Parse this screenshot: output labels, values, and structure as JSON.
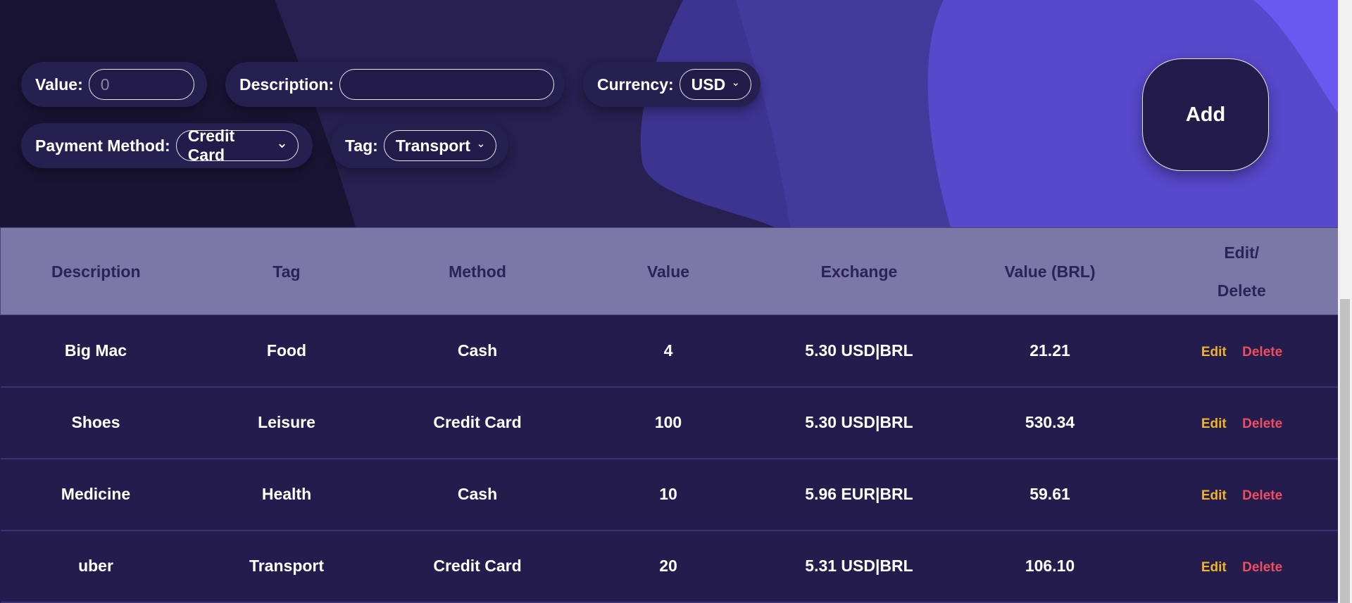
{
  "form": {
    "value_label": "Value:",
    "value_placeholder": "0",
    "description_label": "Description:",
    "description_value": "",
    "currency_label": "Currency:",
    "currency_selected": "USD",
    "payment_label": "Payment Method:",
    "payment_selected": "Credit Card",
    "tag_label": "Tag:",
    "tag_selected": "Transport",
    "add_label": "Add"
  },
  "table": {
    "headers": {
      "description": "Description",
      "tag": "Tag",
      "method": "Method",
      "value": "Value",
      "exchange": "Exchange",
      "value_brl": "Value (BRL)",
      "edit_delete_line1": "Edit/",
      "edit_delete_line2": "Delete"
    },
    "rows": [
      {
        "description": "Big Mac",
        "tag": "Food",
        "method": "Cash",
        "value": "4",
        "exchange": "5.30 USD|BRL",
        "value_brl": "21.21",
        "edit": "Edit",
        "delete": "Delete"
      },
      {
        "description": "Shoes",
        "tag": "Leisure",
        "method": "Credit Card",
        "value": "100",
        "exchange": "5.30 USD|BRL",
        "value_brl": "530.34",
        "edit": "Edit",
        "delete": "Delete"
      },
      {
        "description": "Medicine",
        "tag": "Health",
        "method": "Cash",
        "value": "10",
        "exchange": "5.96 EUR|BRL",
        "value_brl": "59.61",
        "edit": "Edit",
        "delete": "Delete"
      },
      {
        "description": "uber",
        "tag": "Transport",
        "method": "Credit Card",
        "value": "20",
        "exchange": "5.31 USD|BRL",
        "value_brl": "106.10",
        "edit": "Edit",
        "delete": "Delete"
      }
    ]
  },
  "icons": {
    "select_arrow": "chevron-down-icon"
  },
  "colors": {
    "background_dark": "#1c1638",
    "wave_purple": "#4f44c4",
    "wave_bright": "#6a56f2",
    "header_row": "#7b77a6",
    "header_text": "#2b2355",
    "row_bg": "#241c4c",
    "edit_color": "#f0b429",
    "delete_color": "#ef4e5f"
  }
}
